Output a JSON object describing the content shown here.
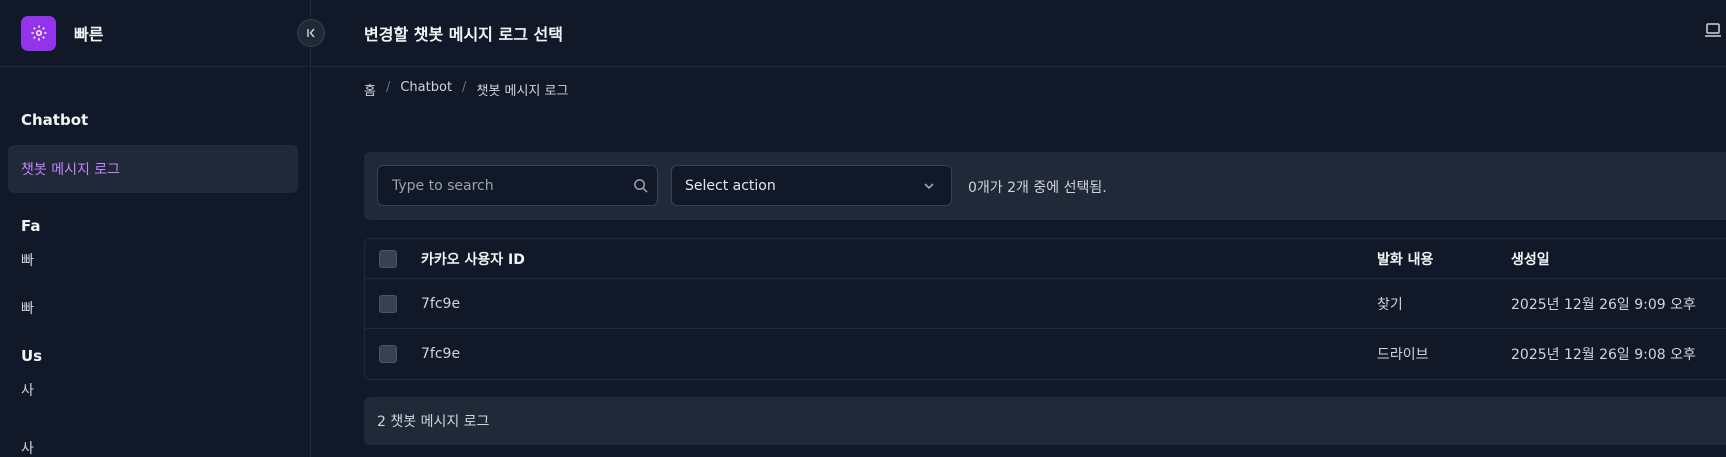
{
  "brand": {
    "name": "빠른"
  },
  "sidebar": {
    "section1": {
      "heading": "Chatbot",
      "active_item": "챗봇 메시지 로그"
    },
    "section2": {
      "heading": "Fa",
      "items": [
        "빠",
        "빠"
      ]
    },
    "section3": {
      "heading": "Us",
      "items": [
        "사"
      ]
    },
    "bottom_text": "사"
  },
  "header": {
    "title": "변경할 챗봇 메시지 로그 선택"
  },
  "breadcrumb": {
    "home": "홈",
    "app": "Chatbot",
    "current": "챗봇 메시지 로그",
    "sep": "/"
  },
  "toolbar": {
    "search_placeholder": "Type to search",
    "action_select": "Select action",
    "selection_count": "0개가 2개 중에 선택됨."
  },
  "table": {
    "columns": [
      "카카오 사용자 ID",
      "발화 내용",
      "생성일"
    ],
    "rows": [
      {
        "id": "7fc9e",
        "message": "찾기",
        "created": "2025년 12월 26일 9:09 오후"
      },
      {
        "id": "7fc9e",
        "message": "드라이브",
        "created": "2025년 12월 26일 9:08 오후"
      }
    ]
  },
  "footer": {
    "count_text": "2 챗봇 메시지 로그"
  },
  "colors": {
    "accent": "#9333ea",
    "active_text": "#c084fc",
    "background": "#111827",
    "panel": "#1f2937"
  }
}
